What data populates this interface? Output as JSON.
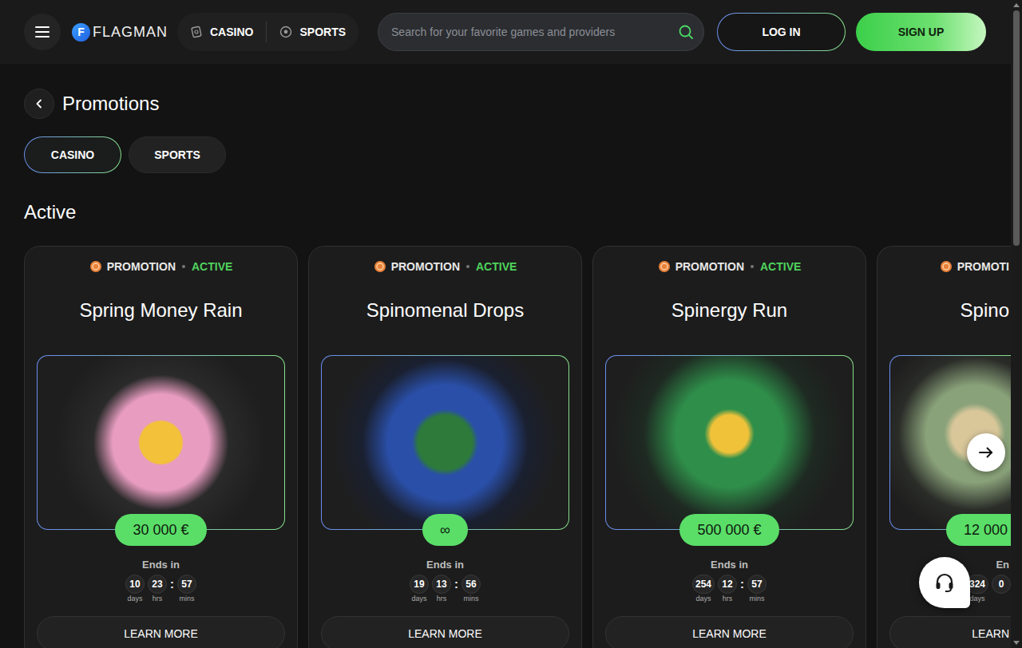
{
  "header": {
    "logo": {
      "mark": "F",
      "name": "FLAGMAN"
    },
    "nav": [
      {
        "label": "CASINO"
      },
      {
        "label": "SPORTS"
      }
    ],
    "search": {
      "placeholder": "Search for your favorite games and providers"
    },
    "login": "LOG IN",
    "signup": "SIGN UP"
  },
  "page": {
    "title": "Promotions"
  },
  "tabs": [
    {
      "label": "CASINO",
      "selected": true
    },
    {
      "label": "SPORTS",
      "selected": false
    }
  ],
  "section": {
    "title": "Active"
  },
  "cards": [
    {
      "kind": "full",
      "type": "PROMOTION",
      "status": "ACTIVE",
      "title": "Spring Money Rain",
      "prize": "30 000 €",
      "ends_label": "Ends in",
      "countdown": [
        {
          "kind": "unit",
          "value": "10",
          "unit": "days"
        },
        {
          "kind": "unit",
          "value": "23",
          "unit": "hrs"
        },
        {
          "kind": "sep",
          "value": ":"
        },
        {
          "kind": "unit",
          "value": "57",
          "unit": "mins"
        }
      ],
      "button": "LEARN MORE"
    },
    {
      "kind": "full",
      "type": "PROMOTION",
      "status": "ACTIVE",
      "title": "Spinomenal Drops",
      "prize": "∞",
      "ends_label": "Ends in",
      "countdown": [
        {
          "kind": "unit",
          "value": "19",
          "unit": "days"
        },
        {
          "kind": "unit",
          "value": "13",
          "unit": "hrs"
        },
        {
          "kind": "sep",
          "value": ":"
        },
        {
          "kind": "unit",
          "value": "56",
          "unit": "mins"
        }
      ],
      "button": "LEARN MORE"
    },
    {
      "kind": "full",
      "type": "PROMOTION",
      "status": "ACTIVE",
      "title": "Spinergy Run",
      "prize": "500 000 €",
      "ends_label": "Ends in",
      "countdown": [
        {
          "kind": "unit",
          "value": "254",
          "unit": "days"
        },
        {
          "kind": "unit",
          "value": "12",
          "unit": "hrs"
        },
        {
          "kind": "sep",
          "value": ":"
        },
        {
          "kind": "unit",
          "value": "57",
          "unit": "mins"
        }
      ],
      "button": "LEARN MORE"
    },
    {
      "kind": "peek",
      "type": "PROMOTI",
      "title": "Spino",
      "prize": "12 000",
      "ends_label": "En",
      "countdown": [
        {
          "kind": "unit",
          "value": "324",
          "unit": "days"
        },
        {
          "kind": "unit",
          "value": "0"
        }
      ],
      "button": "LEARN"
    }
  ]
}
